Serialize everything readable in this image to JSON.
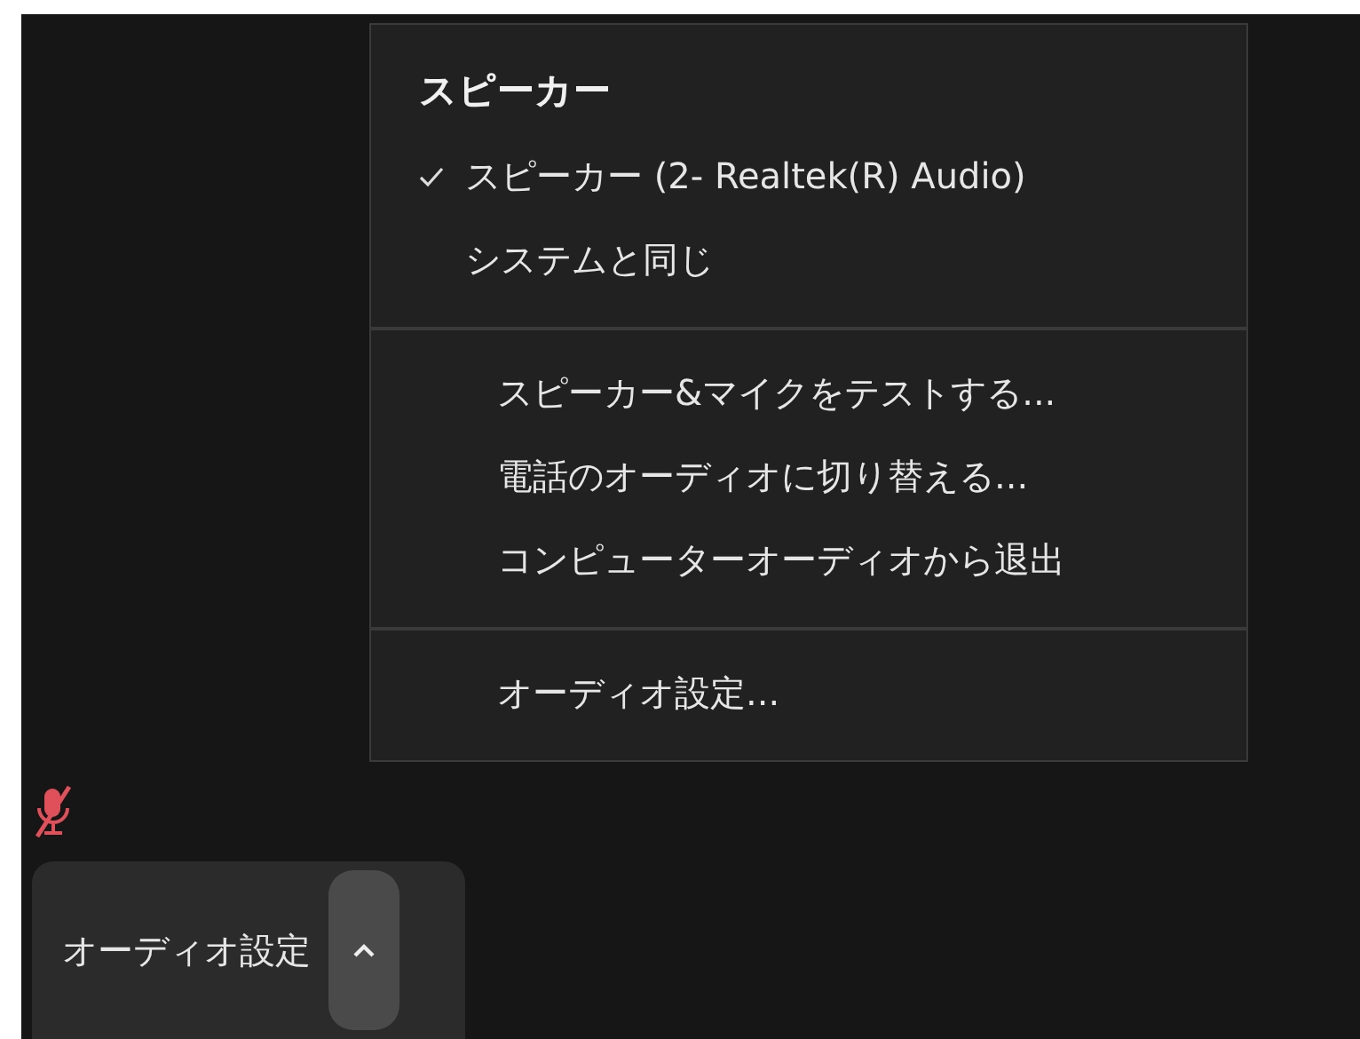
{
  "menu": {
    "sections": [
      {
        "heading": "スピーカー",
        "items": [
          {
            "label": "スピーカー (2- Realtek(R) Audio)",
            "selected": true
          },
          {
            "label": "システムと同じ",
            "selected": false
          }
        ]
      },
      {
        "items": [
          {
            "label": "スピーカー&マイクをテストする..."
          },
          {
            "label": "電話のオーディオに切り替える..."
          },
          {
            "label": "コンピューターオーディオから退出"
          }
        ]
      },
      {
        "items": [
          {
            "label": "オーディオ設定..."
          }
        ]
      }
    ]
  },
  "toolbar": {
    "mic": {
      "muted": true
    },
    "audio_button": {
      "label": "オーディオ設定",
      "expanded": true
    }
  }
}
